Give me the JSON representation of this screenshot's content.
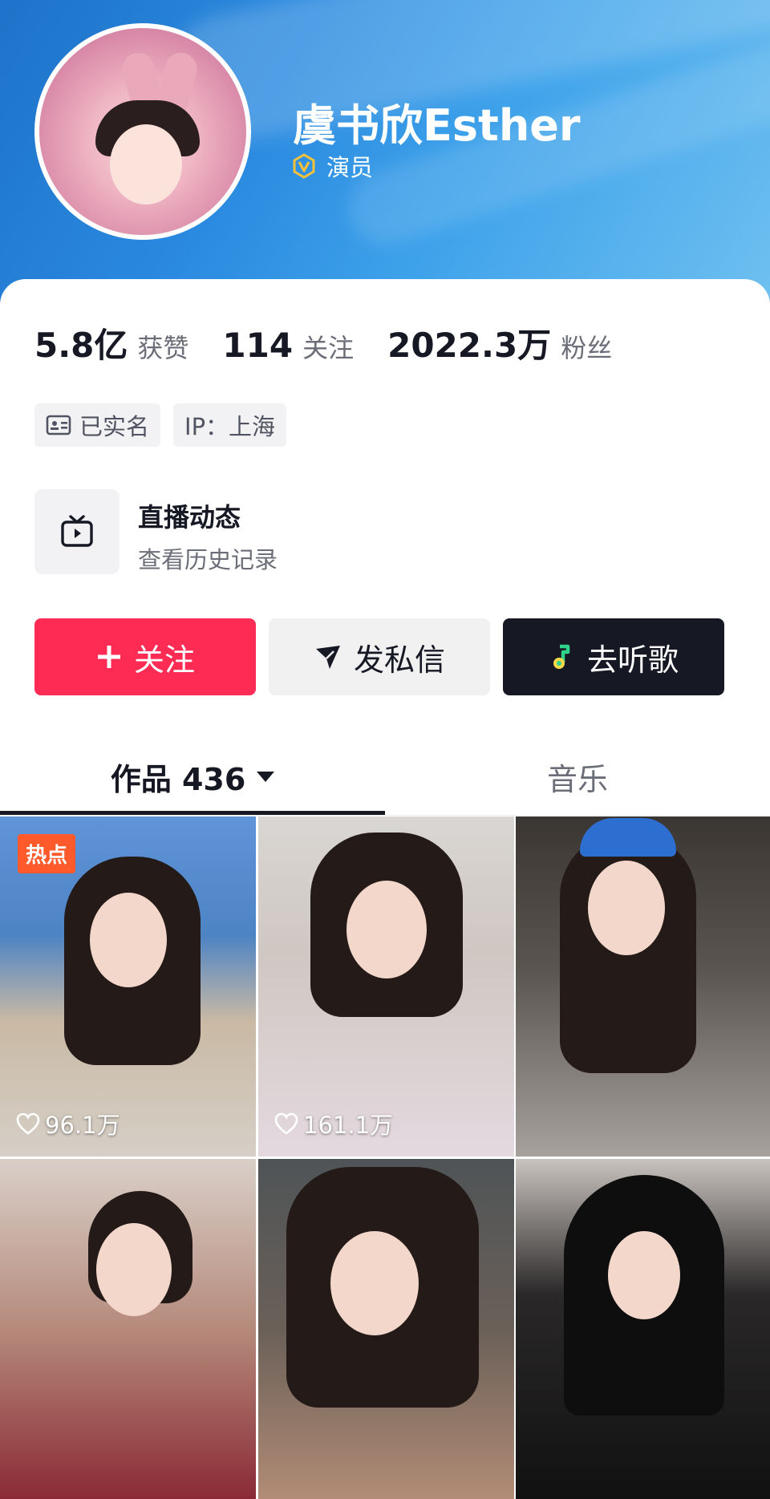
{
  "profile": {
    "name": "虞书欣Esther",
    "verify_label": "演员"
  },
  "stats": [
    {
      "value": "5.8亿",
      "label": "获赞"
    },
    {
      "value": "114",
      "label": "关注"
    },
    {
      "value": "2022.3万",
      "label": "粉丝"
    }
  ],
  "tags": {
    "verified": "已实名",
    "ip": "IP：上海"
  },
  "live": {
    "title": "直播动态",
    "subtitle": "查看历史记录"
  },
  "actions": {
    "follow": "关注",
    "message": "发私信",
    "listen": "去听歌"
  },
  "tabs": {
    "works": "作品 436",
    "music": "音乐"
  },
  "grid": {
    "hot_badge": "热点",
    "items": [
      {
        "likes": "96.1万"
      },
      {
        "likes": "161.1万"
      },
      {
        "likes": ""
      },
      {
        "likes": ""
      },
      {
        "likes": ""
      },
      {
        "likes": ""
      }
    ]
  },
  "icons": {
    "verify": "verified-v-icon",
    "id_card": "id-card-icon",
    "live_tv": "tv-icon",
    "plus": "plus-icon",
    "send": "send-icon",
    "music": "music-note-icon",
    "caret": "caret-down-icon",
    "heart": "heart-icon"
  },
  "colors": {
    "follow_button": "#fe2c55",
    "listen_button": "#161823",
    "verify_badge": "#f5c13a",
    "hot_badge": "#ff5a2b"
  }
}
